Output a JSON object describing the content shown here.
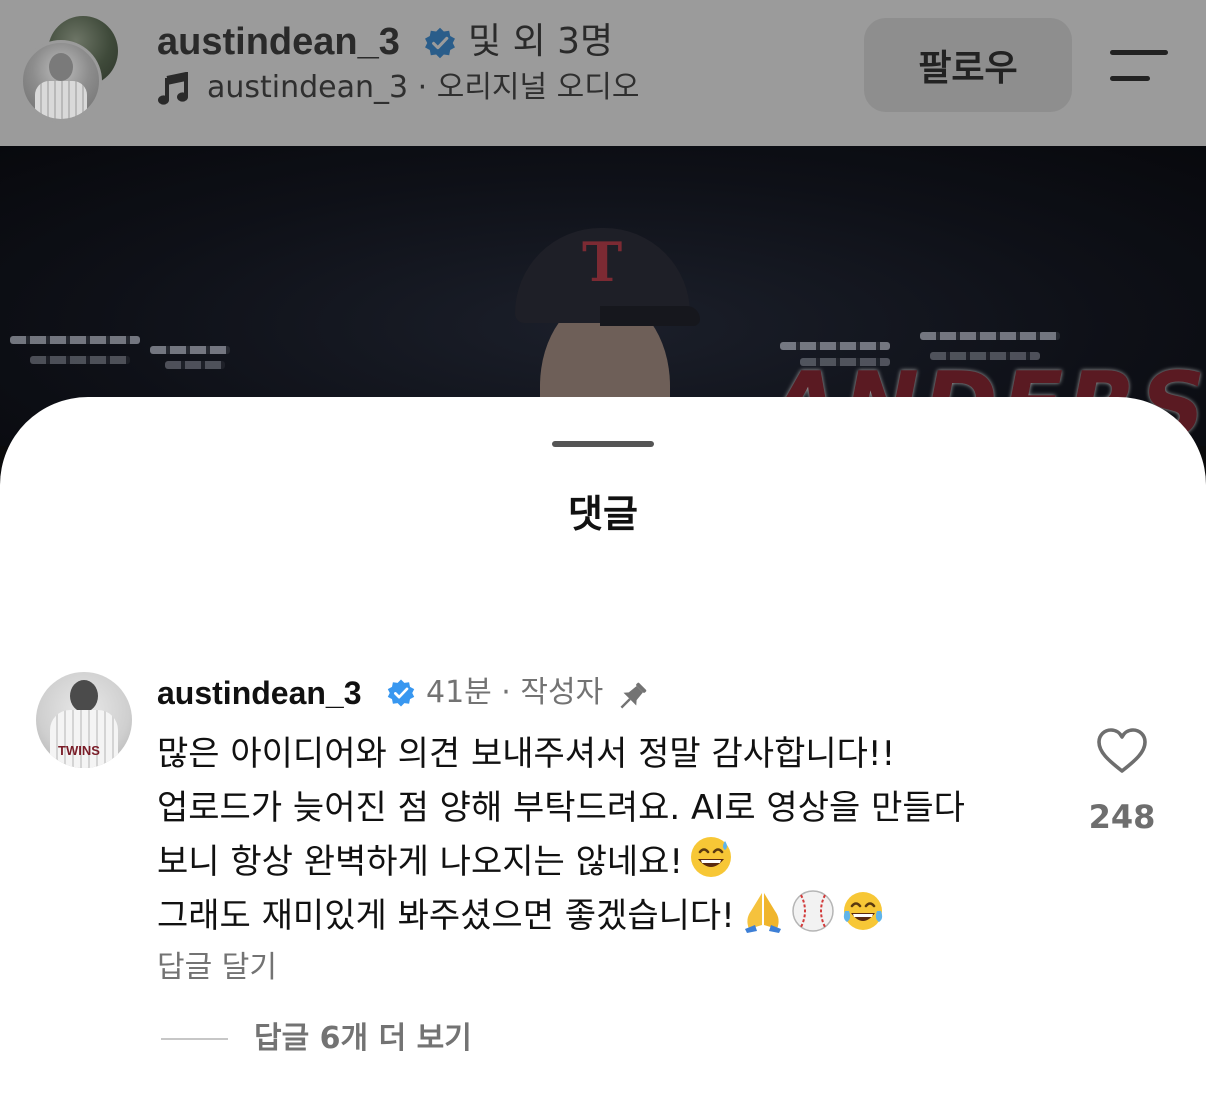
{
  "header": {
    "username": "austindean_3",
    "others_label": "및 외 3명",
    "audio_label": "austindean_3 · 오리지널 오디오",
    "follow_label": "팔로우",
    "icons": [
      "music-note-icon",
      "verified-badge-icon",
      "menu-icon"
    ]
  },
  "video": {
    "cap_logo": "T",
    "overlay_text": "ANDERS"
  },
  "sheet": {
    "title": "댓글"
  },
  "comment": {
    "username": "austindean_3",
    "meta": "41분 · 작성자",
    "avatar_text": "TWINS",
    "lines": [
      "많은 아이디어와 의견 보내주셔서 정말 감사합니다!!",
      "업로드가 늦어진 점 양해 부탁드려요. AI로 영상을 만들다",
      "보니 항상 완벽하게 나오지는 않네요!",
      "그래도 재미있게 봐주셨으면 좋겠습니다!"
    ],
    "emojis": [
      "grinning-sweat-emoji",
      "folded-hands-emoji",
      "baseball-emoji",
      "tears-of-joy-emoji"
    ],
    "like_count": "248",
    "reply_label": "답글 달기",
    "view_replies_label": "답글 6개 더 보기"
  },
  "colors": {
    "verified_blue": "#3897f0",
    "muted_text": "#737373",
    "overlay_dim": "#9b9b9b"
  }
}
